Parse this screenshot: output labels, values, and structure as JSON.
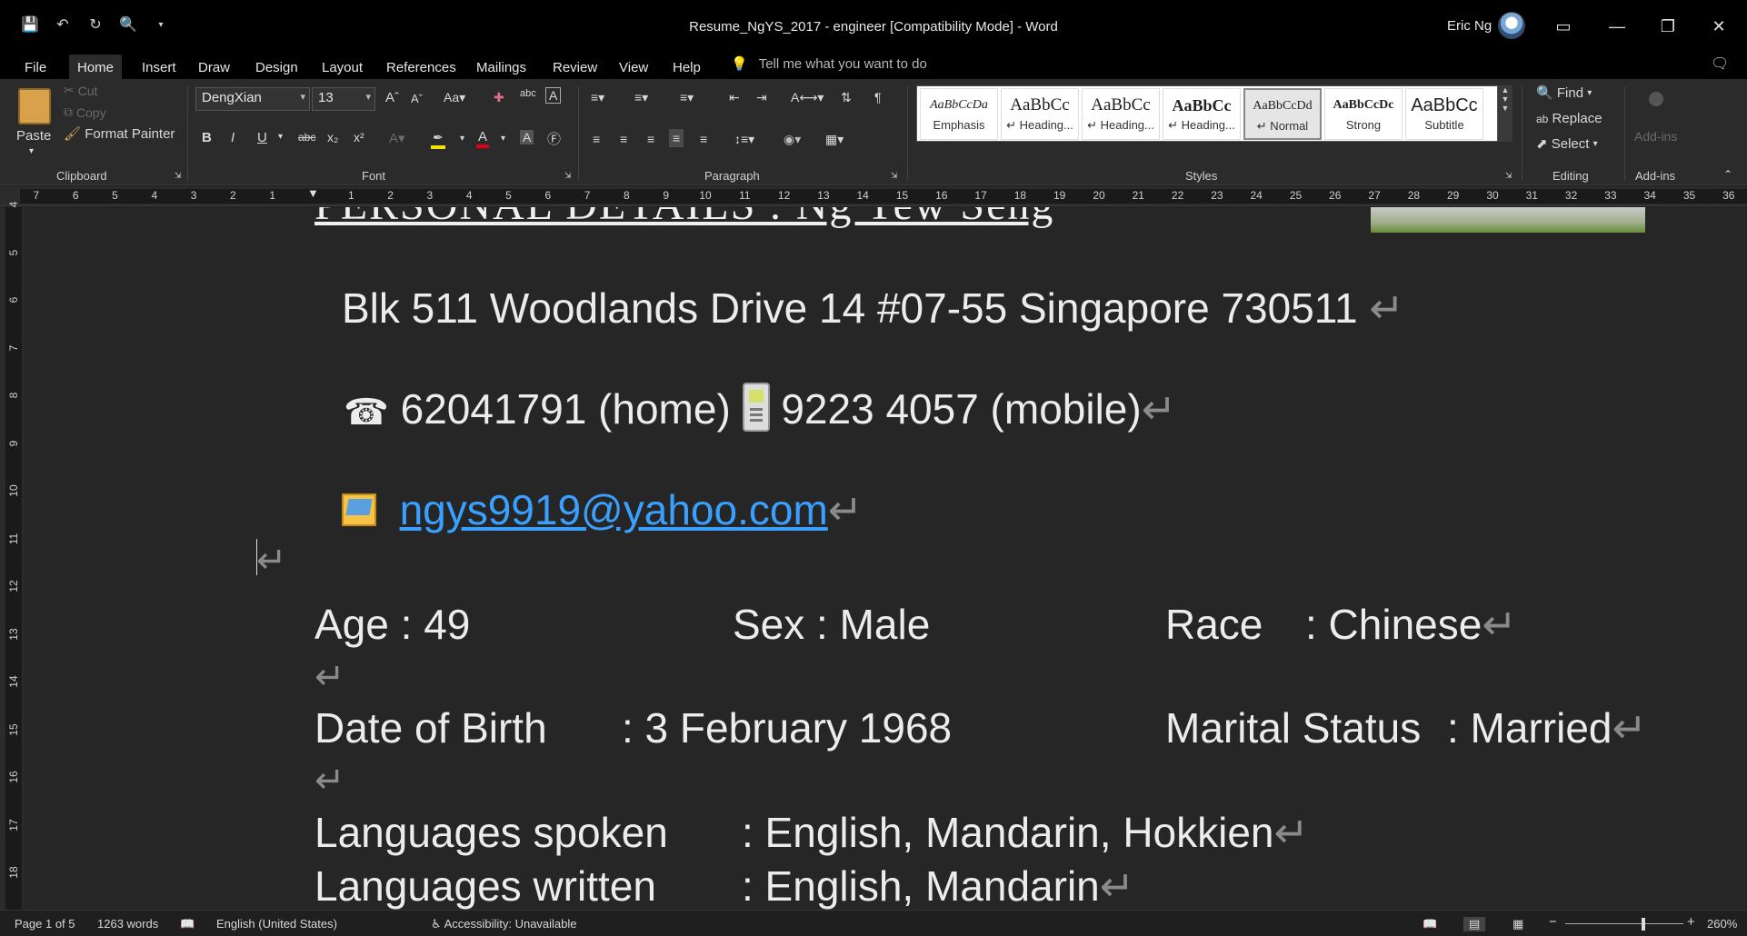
{
  "window": {
    "title": "Resume_NgYS_2017 - engineer [Compatibility Mode]  -  Word",
    "user": "Eric Ng",
    "qat_icons": [
      "save-icon",
      "undo-icon",
      "redo-icon",
      "print-preview-icon",
      "customize-icon"
    ]
  },
  "tabs": [
    "File",
    "Home",
    "Insert",
    "Draw",
    "Design",
    "Layout",
    "References",
    "Mailings",
    "Review",
    "View",
    "Help"
  ],
  "tell_me": "Tell me what you want to do",
  "ribbon": {
    "clipboard": {
      "paste": "Paste",
      "cut": "Cut",
      "copy": "Copy",
      "format_painter": "Format Painter",
      "label": "Clipboard"
    },
    "font": {
      "name": "DengXian",
      "size": "13",
      "label": "Font",
      "buttons": [
        "B",
        "I",
        "U",
        "abc",
        "x₂",
        "x²"
      ]
    },
    "paragraph": {
      "label": "Paragraph"
    },
    "styles": {
      "label": "Styles",
      "items": [
        {
          "sample": "AaBbCcDa",
          "name": "Emphasis"
        },
        {
          "sample": "AaBbCc",
          "name": "↵ Heading..."
        },
        {
          "sample": "AaBbCc",
          "name": "↵ Heading..."
        },
        {
          "sample": "AaBbCc",
          "name": "↵ Heading..."
        },
        {
          "sample": "AaBbCcDd",
          "name": "↵ Normal"
        },
        {
          "sample": "AaBbCcDc",
          "name": "Strong"
        },
        {
          "sample": "AaBbCc",
          "name": "Subtitle"
        }
      ]
    },
    "editing": {
      "label": "Editing",
      "find": "Find",
      "replace": "Replace",
      "select": "Select"
    },
    "addins": {
      "label": "Add-ins",
      "button": "Add-ins"
    }
  },
  "ruler": {
    "left_numbers": [
      "7",
      "6",
      "5",
      "4",
      "3",
      "2",
      "1"
    ],
    "right_numbers": [
      "1",
      "2",
      "3",
      "4",
      "5",
      "6",
      "7",
      "8",
      "9",
      "10",
      "11",
      "12",
      "13",
      "14",
      "15",
      "16",
      "17",
      "18",
      "19",
      "20",
      "21",
      "22",
      "23",
      "24",
      "25",
      "26",
      "27",
      "28",
      "29",
      "30",
      "31",
      "32",
      "33",
      "34",
      "35",
      "36"
    ],
    "vertical_numbers": [
      "4",
      "5",
      "6",
      "7",
      "8",
      "9",
      "10",
      "11",
      "12",
      "13",
      "14",
      "15",
      "16",
      "17",
      "18"
    ]
  },
  "document": {
    "heading_partial": "PERSONAL DETAILS :  Ng Yew Seng",
    "address": "Blk 511  Woodlands Drive 14 #07-55 Singapore 730511 ",
    "phone_home": " 62041791 (home) ",
    "phone_mobile": " 9223 4057 (mobile)",
    "email": "ngys9919@yahoo.com",
    "age_label": "Age : 49",
    "sex_label": "Sex : Male",
    "race_label": "Race",
    "race_value": ": Chinese",
    "dob_label": "Date of Birth",
    "dob_value": ": 3 February 1968",
    "marital_label": "Marital Status",
    "marital_value": ": Married",
    "lang_spoken_label": "Languages spoken",
    "lang_spoken_value": ": English, Mandarin, Hokkien",
    "lang_written_label": "Languages written",
    "lang_written_value": ": English, Mandarin",
    "para_mark": "↵"
  },
  "status": {
    "page": "Page 1 of 5",
    "words": "1263 words",
    "language": "English (United States)",
    "accessibility": "Accessibility: Unavailable",
    "zoom": "260%"
  }
}
